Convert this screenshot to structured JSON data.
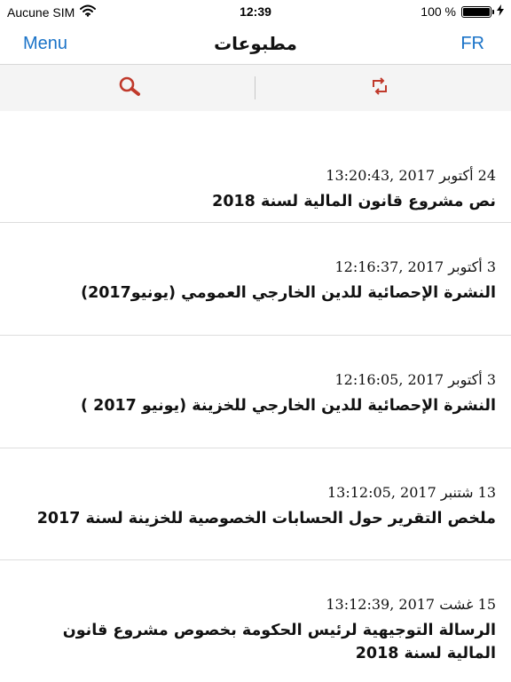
{
  "status_bar": {
    "carrier": "Aucune SIM",
    "time": "12:39",
    "battery_label": "100 %",
    "battery_level": 1.0
  },
  "nav": {
    "left_label": "Menu",
    "title": "مطبوعات",
    "right_label": "FR"
  },
  "toolbar": {
    "search_icon": "search-icon",
    "refresh_icon": "refresh-icon",
    "accent_color": "#c0392b"
  },
  "publications": [
    {
      "date": "24 أكتوبر 2017 ,13:20:43",
      "title": "نص مشروع قانون المالية لسنة 2018"
    },
    {
      "date": "3 أكتوبر 2017 ,12:16:37",
      "title": "النشرة الإحصائية للدين الخارجي العمومي (يونيو2017)"
    },
    {
      "date": "3 أكتوبر 2017 ,12:16:05",
      "title": "النشرة الإحصائية للدين الخارجي للخزينة (يونيو 2017 )"
    },
    {
      "date": "13 شتنبر 2017 ,13:12:05",
      "title": "ملخص التقرير حول الحسابات الخصوصية للخزينة لسنة 2017"
    },
    {
      "date": "15 غشت 2017 ,13:12:39",
      "title": "الرسالة التوجيهية لرئيس الحكومة بخصوص مشروع قانون المالية لسنة 2018"
    }
  ]
}
